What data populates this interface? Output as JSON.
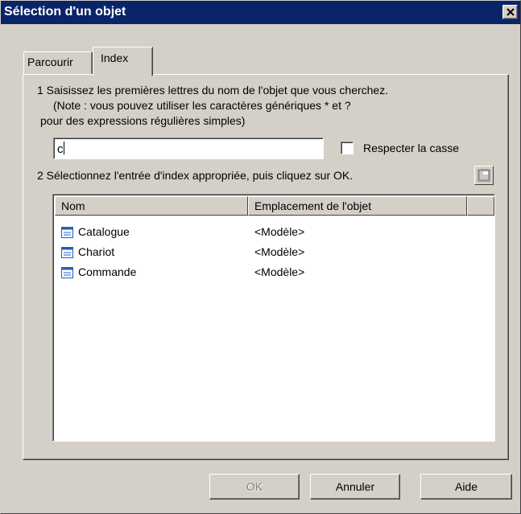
{
  "window": {
    "title": "Sélection d'un objet"
  },
  "tabs": [
    {
      "label": "Parcourir",
      "active": false
    },
    {
      "label": "Index",
      "active": true
    }
  ],
  "step1": {
    "line1": "1  Saisissez les premières lettres du nom de l'objet que vous cherchez.",
    "line2": "(Note : vous pouvez utiliser les caractères génériques * et ?",
    "line3": "pour des expressions régulières simples)",
    "search_value": "c",
    "match_case_label": "Respecter la casse",
    "match_case_checked": false
  },
  "step2": {
    "instruction": "2  Sélectionnez l'entrée d'index appropriée, puis cliquez sur OK."
  },
  "list": {
    "columns": [
      "Nom",
      "Emplacement de l'objet"
    ],
    "rows": [
      {
        "name": "Catalogue",
        "location": "<Modèle>",
        "icon": "entity-icon"
      },
      {
        "name": "Chariot",
        "location": "<Modèle>",
        "icon": "entity-icon"
      },
      {
        "name": "Commande",
        "location": "<Modèle>",
        "icon": "entity-icon"
      }
    ]
  },
  "buttons": {
    "ok": "OK",
    "cancel": "Annuler",
    "help": "Aide"
  },
  "colors": {
    "titlebar": "#0a246a",
    "face": "#d4d0c8",
    "icon": "#1f5fbf"
  }
}
